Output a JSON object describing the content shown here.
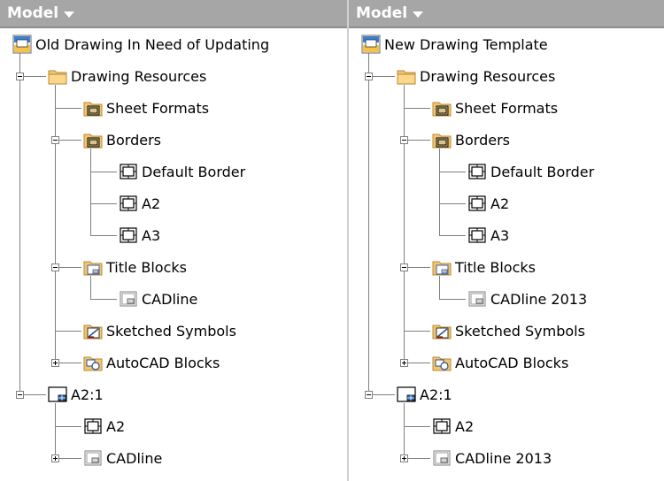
{
  "left": {
    "header": "Model",
    "items": [
      {
        "label": "Old Drawing In Need of Updating"
      },
      {
        "label": "Drawing Resources"
      },
      {
        "label": "Sheet Formats"
      },
      {
        "label": "Borders"
      },
      {
        "label": "Default Border"
      },
      {
        "label": "A2"
      },
      {
        "label": "A3"
      },
      {
        "label": "Title Blocks"
      },
      {
        "label": "CADline"
      },
      {
        "label": "Sketched Symbols"
      },
      {
        "label": "AutoCAD Blocks"
      },
      {
        "label": "A2:1"
      },
      {
        "label": "A2"
      },
      {
        "label": "CADline"
      }
    ]
  },
  "right": {
    "header": "Model",
    "items": [
      {
        "label": "New Drawing Template"
      },
      {
        "label": "Drawing Resources"
      },
      {
        "label": "Sheet Formats"
      },
      {
        "label": "Borders"
      },
      {
        "label": "Default Border"
      },
      {
        "label": "A2"
      },
      {
        "label": "A3"
      },
      {
        "label": "Title Blocks"
      },
      {
        "label": "CADline 2013"
      },
      {
        "label": "Sketched Symbols"
      },
      {
        "label": "AutoCAD Blocks"
      },
      {
        "label": "A2:1"
      },
      {
        "label": "A2"
      },
      {
        "label": "CADline 2013"
      }
    ]
  }
}
